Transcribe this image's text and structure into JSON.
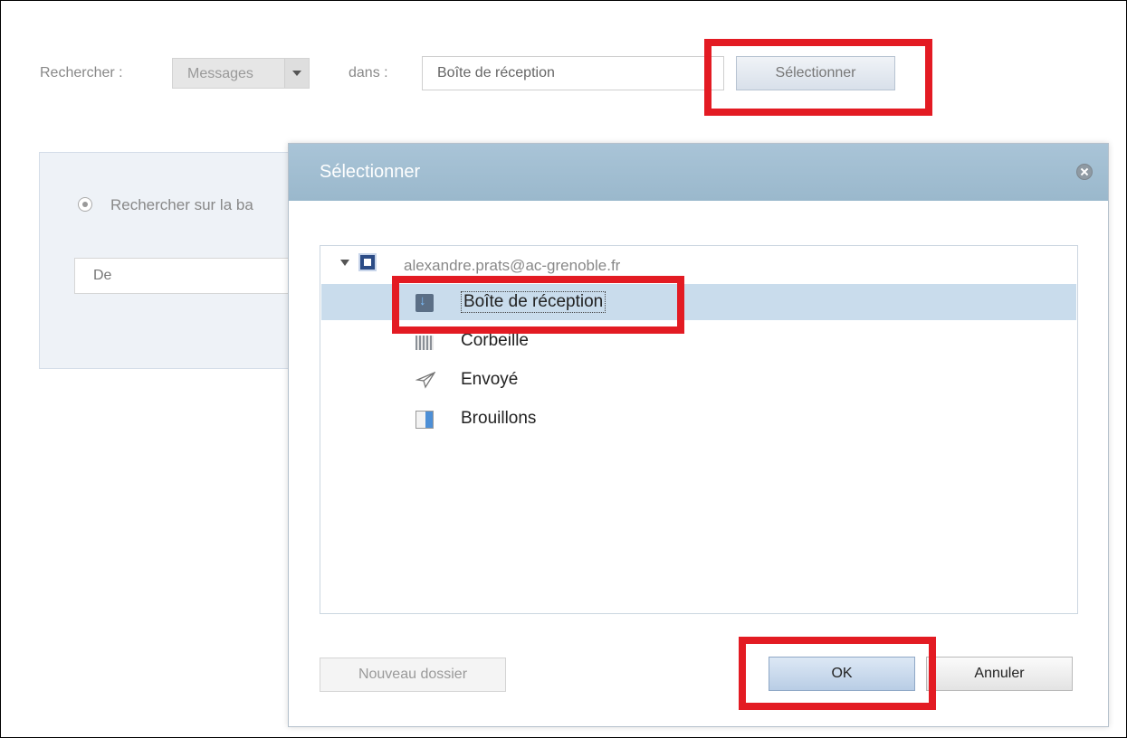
{
  "search": {
    "label": "Rechercher :",
    "type_select": "Messages",
    "in_label": "dans :",
    "folder_value": "Boîte de réception",
    "select_button": "Sélectionner"
  },
  "background_panel": {
    "radio_label": "Rechercher sur la ba",
    "from_field": "De"
  },
  "dialog": {
    "title": "Sélectionner",
    "account": "alexandre.prats@ac-grenoble.fr",
    "folders": [
      {
        "label": "Boîte de réception",
        "icon": "inbox-icon",
        "selected": true
      },
      {
        "label": "Corbeille",
        "icon": "trash-icon",
        "selected": false
      },
      {
        "label": "Envoyé",
        "icon": "sent-icon",
        "selected": false
      },
      {
        "label": "Brouillons",
        "icon": "drafts-icon",
        "selected": false
      }
    ],
    "new_folder_button": "Nouveau dossier",
    "ok_button": "OK",
    "cancel_button": "Annuler"
  },
  "colors": {
    "highlight": "#e31b23",
    "dialog_header": "#a9c4d7",
    "selected_row": "#c9dcec"
  }
}
